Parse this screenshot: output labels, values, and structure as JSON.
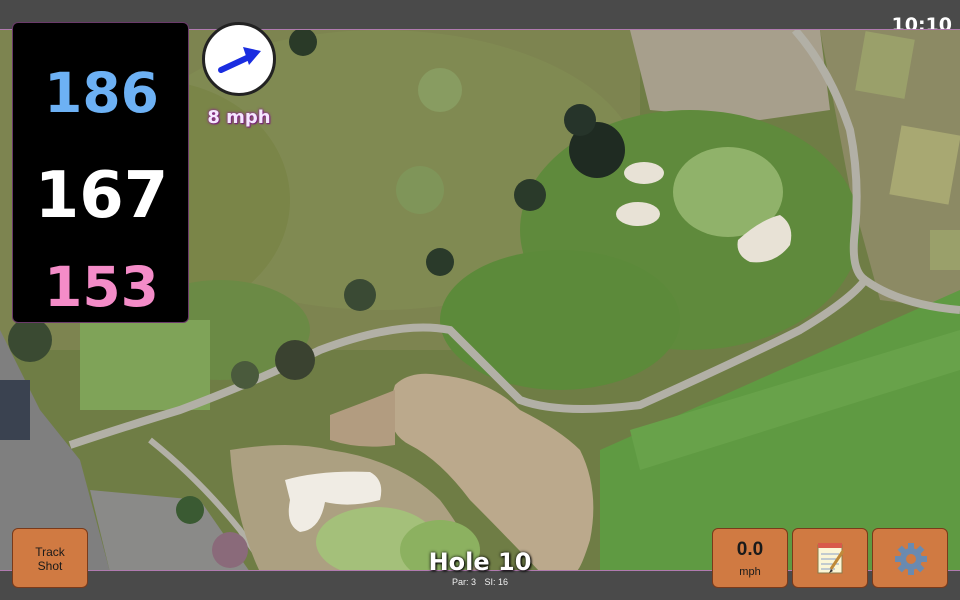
{
  "status": {
    "time": "10:10"
  },
  "distances": {
    "back": "186",
    "middle": "167",
    "front": "153"
  },
  "wind": {
    "speed_text": "8 mph",
    "icon": "wind-arrow-icon"
  },
  "hole": {
    "title": "Hole 10",
    "par_text": "Par: 3",
    "si_text": "SI: 16"
  },
  "buttons": {
    "track_shot_line1": "Track",
    "track_shot_line2": "Shot",
    "wind_value": "0.0",
    "wind_unit": "mph",
    "notes_icon": "notepad-icon",
    "settings_icon": "gear-icon"
  },
  "colors": {
    "back": "#6db1f4",
    "middle": "#ffffff",
    "front": "#f48cc8",
    "button": "#d07a42"
  }
}
